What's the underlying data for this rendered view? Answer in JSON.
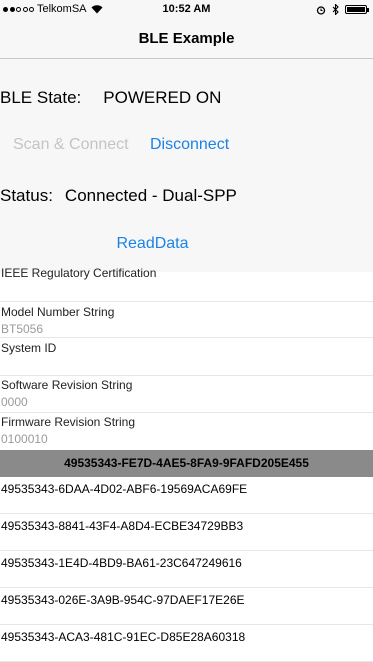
{
  "status_bar": {
    "carrier": "TelkomSA",
    "time": "10:52 AM",
    "signal_bars_filled": 2,
    "signal_bars_total": 5,
    "icons": [
      "wifi-icon",
      "alarm-icon",
      "bluetooth-icon",
      "battery-icon"
    ]
  },
  "nav": {
    "title": "BLE Example"
  },
  "ble": {
    "state_label": "BLE State:",
    "state_value": "POWERED ON",
    "scan_button": "Scan & Connect",
    "disconnect_button": "Disconnect",
    "status_label": "Status:",
    "status_value": "Connected - Dual-SPP",
    "read_button": "ReadData"
  },
  "device_info": [
    {
      "title": "IEEE Regulatory Certification",
      "value": ""
    },
    {
      "title": "Model Number String",
      "value": "BT5056"
    },
    {
      "title": "System ID",
      "value": ""
    },
    {
      "title": "Software Revision String",
      "value": "0000"
    },
    {
      "title": "Firmware Revision String",
      "value": "0100010"
    }
  ],
  "service": {
    "uuid": "49535343-FE7D-4AE5-8FA9-9FAFD205E455",
    "characteristics": [
      "49535343-6DAA-4D02-ABF6-19569ACA69FE",
      "49535343-8841-43F4-A8D4-ECBE34729BB3",
      "49535343-1E4D-4BD9-BA61-23C647249616",
      "49535343-026E-3A9B-954C-97DAEF17E26E",
      "49535343-ACA3-481C-91EC-D85E28A60318"
    ]
  },
  "colors": {
    "accent": "#1a83e8",
    "disabled": "#c4c4c4",
    "panel_bg": "#f7f7f7",
    "section_header_bg": "#8a8a8a"
  }
}
